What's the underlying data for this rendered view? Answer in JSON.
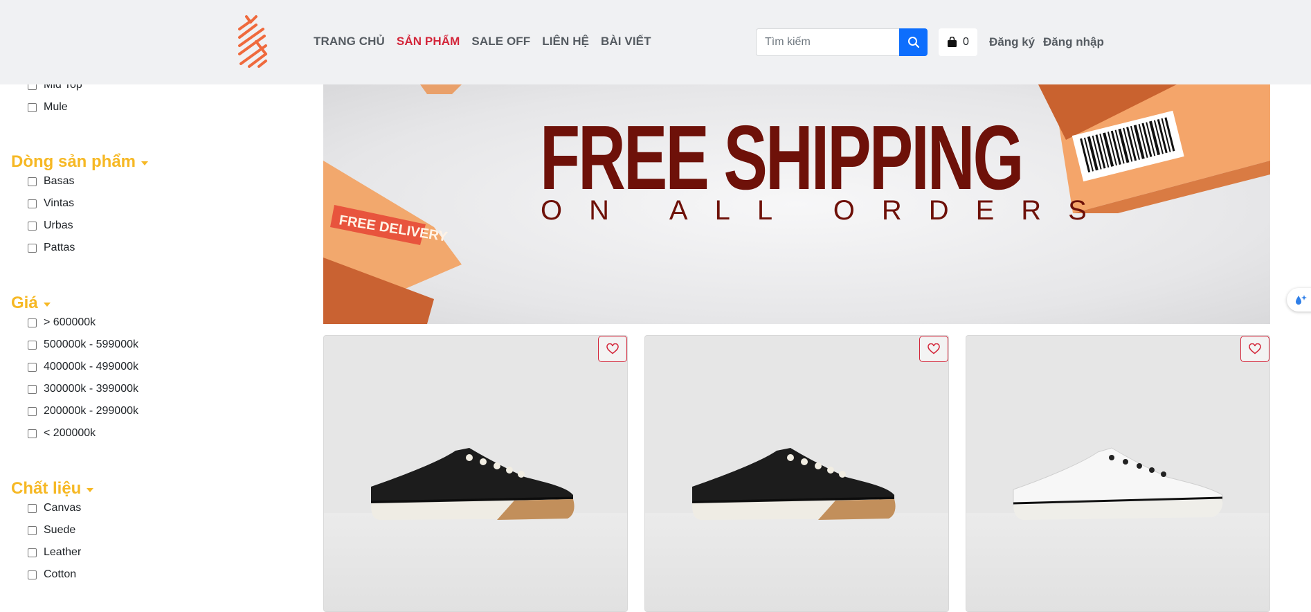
{
  "header": {
    "logo_name": "pineapple-logo",
    "nav": [
      {
        "label": "TRANG CHỦ",
        "active": false
      },
      {
        "label": "SẢN PHẨM",
        "active": true
      },
      {
        "label": "SALE OFF",
        "active": false
      },
      {
        "label": "LIÊN HỆ",
        "active": false
      },
      {
        "label": "BÀI VIẾT",
        "active": false
      }
    ],
    "search": {
      "placeholder": "Tìm kiếm",
      "value": ""
    },
    "cart_count": "0",
    "register_label": "Đăng ký",
    "login_label": "Đăng nhập"
  },
  "sidebar": {
    "partial_top_option": "Mid Top",
    "style_options": [
      "Mule"
    ],
    "product_line": {
      "title": "Dòng sản phẩm",
      "options": [
        "Basas",
        "Vintas",
        "Urbas",
        "Pattas"
      ]
    },
    "price": {
      "title": "Giá",
      "options": [
        "> 600000k",
        "500000k - 599000k",
        "400000k - 499000k",
        "300000k - 399000k",
        "200000k - 299000k",
        "< 200000k"
      ]
    },
    "material": {
      "title": "Chất liệu",
      "options": [
        "Canvas",
        "Suede",
        "Leather",
        "Cotton"
      ]
    }
  },
  "banner": {
    "title": "FREE SHIPPING",
    "subtitle": "ON ALL ORDERS",
    "sticker": "FREE DELIVERY"
  },
  "products": [
    {
      "color": "black",
      "sole": "gum"
    },
    {
      "color": "black",
      "sole": "gum"
    },
    {
      "color": "white",
      "sole": "white"
    }
  ],
  "colors": {
    "accent": "#d3263a",
    "filter_title": "#f6b824",
    "search_button": "#0d6efd",
    "banner_text": "#6e1109"
  }
}
